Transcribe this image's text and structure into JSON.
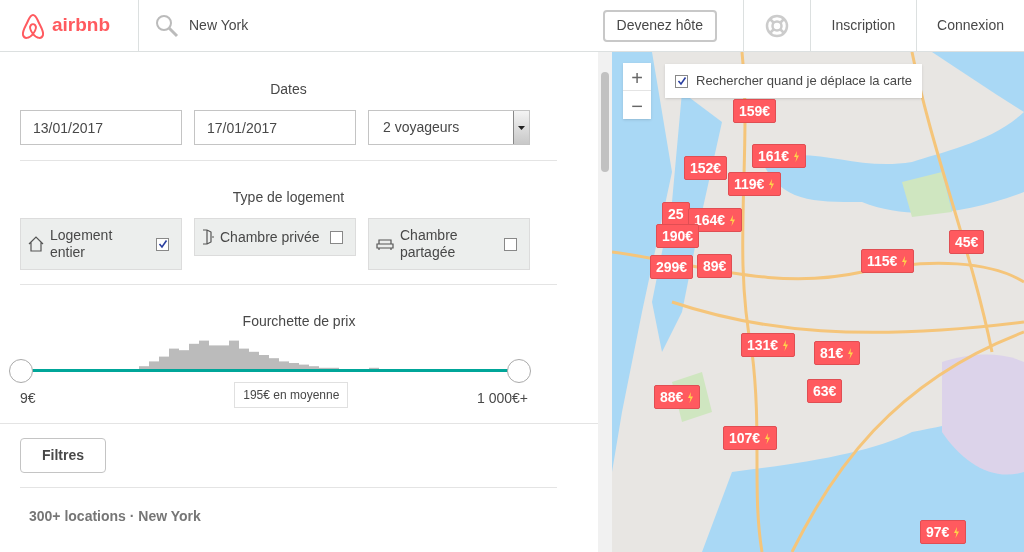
{
  "header": {
    "logo": "airbnb",
    "search": {
      "value": "New York"
    },
    "host_button": "Devenez hôte",
    "links": [
      "Inscription",
      "Connexion"
    ]
  },
  "dates": {
    "title": "Dates",
    "checkin": "13/01/2017",
    "checkout": "17/01/2017",
    "guests": "2 voyageurs"
  },
  "room_types": {
    "title": "Type de logement",
    "items": [
      {
        "kind": "house",
        "label": "Logement entier",
        "checked": true
      },
      {
        "kind": "door",
        "label": "Chambre privée",
        "checked": false
      },
      {
        "kind": "couch",
        "label": "Chambre partagée",
        "checked": false
      }
    ]
  },
  "price": {
    "title": "Fourchette de prix",
    "thumbs": [
      {
        "level": 0
      },
      {
        "level": 1
      }
    ],
    "min": "9€",
    "max": "1 000€+",
    "average": "195€ en moyenne"
  },
  "filters_button": "Filtres",
  "results": "300+ locations · New York",
  "map": {
    "kind": "picture",
    "zoom_in": "+",
    "zoom_out": "−",
    "search_on_move": {
      "label": "Rechercher quand je déplace la carte",
      "checked": true
    },
    "markers": [
      {
        "price": "159€",
        "instant": false
      },
      {
        "price": "152€",
        "instant": false
      },
      {
        "price": "161€",
        "instant": true
      },
      {
        "price": "119€",
        "instant": true
      },
      {
        "price": "25",
        "instant": false
      },
      {
        "price": "164€",
        "instant": true
      },
      {
        "price": "190€",
        "instant": false
      },
      {
        "price": "299€",
        "instant": false
      },
      {
        "price": "89€",
        "instant": false
      },
      {
        "price": "115€",
        "instant": true
      },
      {
        "price": "45€",
        "instant": false
      },
      {
        "price": "131€",
        "instant": true
      },
      {
        "price": "81€",
        "instant": true
      },
      {
        "price": "88€",
        "instant": true
      },
      {
        "price": "63€",
        "instant": false
      },
      {
        "price": "107€",
        "instant": true
      },
      {
        "price": "97€",
        "instant": true
      }
    ]
  }
}
